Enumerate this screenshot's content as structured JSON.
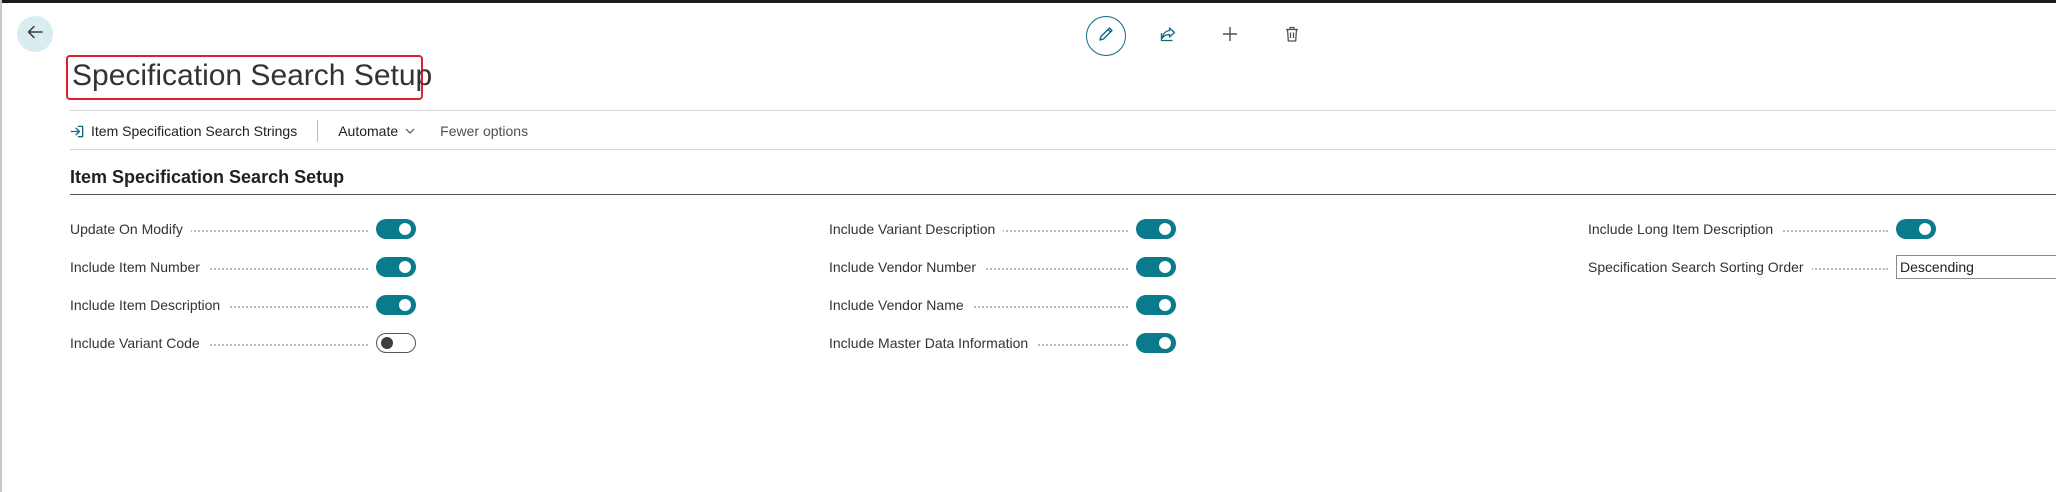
{
  "page": {
    "title": "Specification Search Setup"
  },
  "icons": {
    "back": "arrow-left-icon",
    "edit": "pencil-icon",
    "share": "share-icon",
    "new": "plus-icon",
    "delete": "trash-icon",
    "action_item": "sign-in-arrow-icon",
    "dropdown": "chevron-down-icon"
  },
  "colors": {
    "accent": "#0a7b8c",
    "highlight_border": "#e0202c",
    "back_button_bg": "#d9ecef"
  },
  "action_bar": {
    "items": [
      {
        "label": "Item Specification Search Strings"
      },
      {
        "label": "Automate"
      },
      {
        "label": "Fewer options"
      }
    ]
  },
  "section": {
    "title": "Item Specification Search Setup"
  },
  "fields": {
    "col1": [
      {
        "label": "Update On Modify",
        "type": "toggle",
        "value": true
      },
      {
        "label": "Include Item Number",
        "type": "toggle",
        "value": true
      },
      {
        "label": "Include Item Description",
        "type": "toggle",
        "value": true
      },
      {
        "label": "Include Variant Code",
        "type": "toggle",
        "value": false
      }
    ],
    "col2": [
      {
        "label": "Include Variant Description",
        "type": "toggle",
        "value": true
      },
      {
        "label": "Include Vendor Number",
        "type": "toggle",
        "value": true
      },
      {
        "label": "Include Vendor Name",
        "type": "toggle",
        "value": true
      },
      {
        "label": "Include Master Data Information",
        "type": "toggle",
        "value": true
      }
    ],
    "col3": [
      {
        "label": "Include Long Item Description",
        "type": "toggle",
        "value": true
      },
      {
        "label": "Specification Search Sorting Order",
        "type": "select",
        "value": "Descending"
      }
    ]
  }
}
